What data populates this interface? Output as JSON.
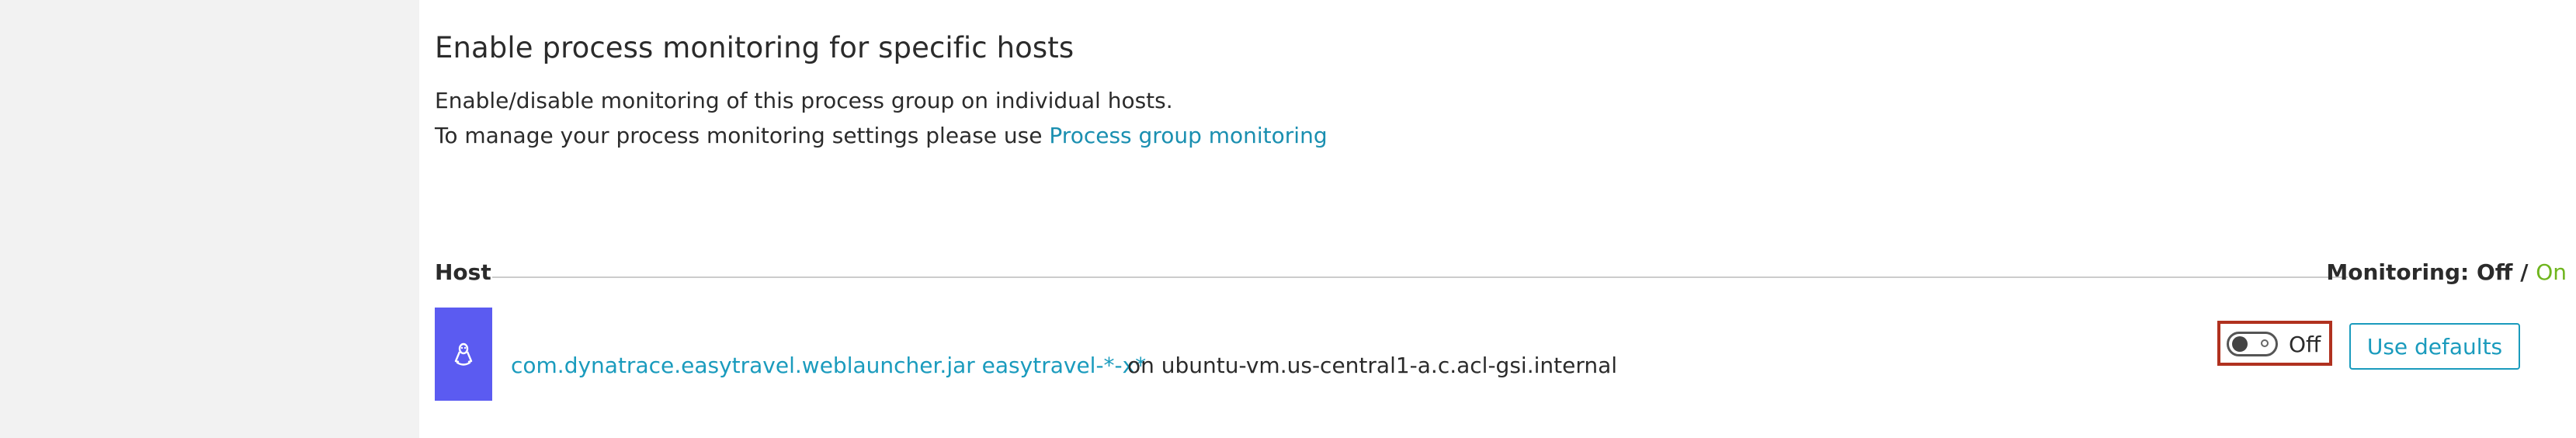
{
  "section": {
    "title": "Enable process monitoring for specific hosts",
    "description_line1": "Enable/disable monitoring of this process group on individual hosts.",
    "description_line2_prefix": "To manage your process monitoring settings please use ",
    "description_link": "Process group monitoring"
  },
  "table": {
    "host_header": "Host",
    "monitoring_prefix": "Monitoring: ",
    "monitoring_off": "Off",
    "monitoring_sep": " / ",
    "monitoring_on": "On",
    "rows": [
      {
        "process_group": "com.dynatrace.easytravel.weblauncher.jar easytravel-*-x*",
        "host": "on ubuntu-vm.us-central1-a.c.acl-gsi.internal",
        "toggle_state": "Off",
        "defaults_label": "Use defaults",
        "os_icon": "linux-icon"
      }
    ]
  },
  "colors": {
    "accent_link": "#1a9bbd",
    "on_green": "#6fb51e",
    "host_tile": "#5b5bf1",
    "highlight": "#b0311f"
  }
}
